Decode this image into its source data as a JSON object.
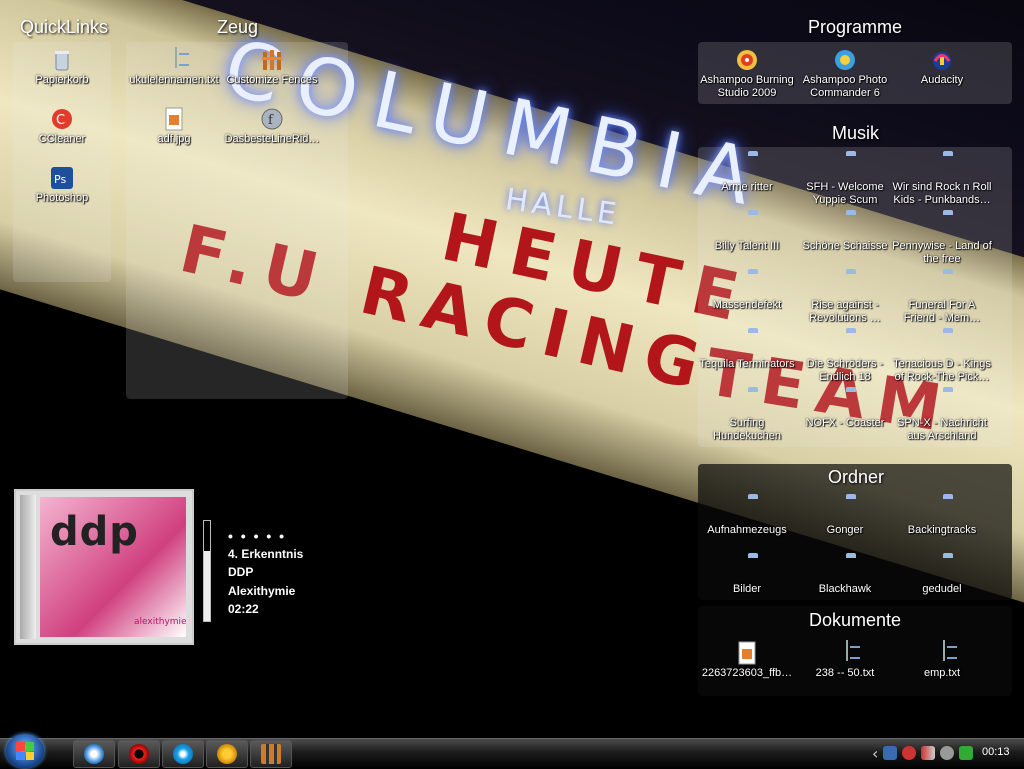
{
  "fences": {
    "quicklinks": {
      "title": "QuickLinks",
      "items": [
        "Papierkorb",
        "CCleaner",
        "Photoshop"
      ]
    },
    "zeug": {
      "title": "Zeug",
      "items": [
        "ukulelennamen.txt",
        "Customize Fences",
        "adf.jpg",
        "DasbesteLineRid…"
      ]
    },
    "programme": {
      "title": "Programme",
      "items": [
        "Ashampoo Burning Studio 2009",
        "Ashampoo Photo Commander 6",
        "Audacity"
      ]
    },
    "musik": {
      "title": "Musik",
      "items": [
        "Arme ritter",
        "SFH - Welcome Yuppie Scum",
        "Wir sind Rock n Roll Kids - Punkbands…",
        "Billy Talent III",
        "Schöne Schaisse",
        "Pennywise - Land of the free",
        "Massendefekt",
        "Rise against - Revolutions …",
        "Funeral For A Friend - Mem…",
        "Tequila Terminators",
        "Die Schröders - Endlich 18",
        "Tenacious D - Kings of Rock-The Pick…",
        "Surfing Hundekuchen",
        "NOFX - Coaster",
        "SPN-X - Nachricht aus Arschland"
      ]
    },
    "ordner": {
      "title": "Ordner",
      "items": [
        "Aufnahmezeugs",
        "Gonger",
        "Backingtracks",
        "Bilder",
        "Blackhawk",
        "gedudel"
      ]
    },
    "dokumente": {
      "title": "Dokumente",
      "items": [
        "2263723603_ffb…",
        "238 -- 50.txt",
        "emp.txt"
      ]
    }
  },
  "wallpaper": {
    "neon": "COLUMBIA",
    "halle": "HALLE",
    "line1": "HEUTE",
    "line2": "F.U RACING",
    "line3": "TEAM"
  },
  "player": {
    "dots": "• • • • •",
    "track": "4. Erkenntnis",
    "artist": "DDP",
    "album": "Alexithymie",
    "time": "02:22",
    "album_logo": "ddp",
    "album_sub": "alexithymie",
    "volume_fraction": 0.7
  },
  "taskbar": {
    "pinned": [
      "media-player-icon",
      "opera-icon",
      "skype-icon",
      "winamp-icon",
      "fences-icon"
    ],
    "tray_chevron": "‹",
    "clock": "00:13"
  }
}
